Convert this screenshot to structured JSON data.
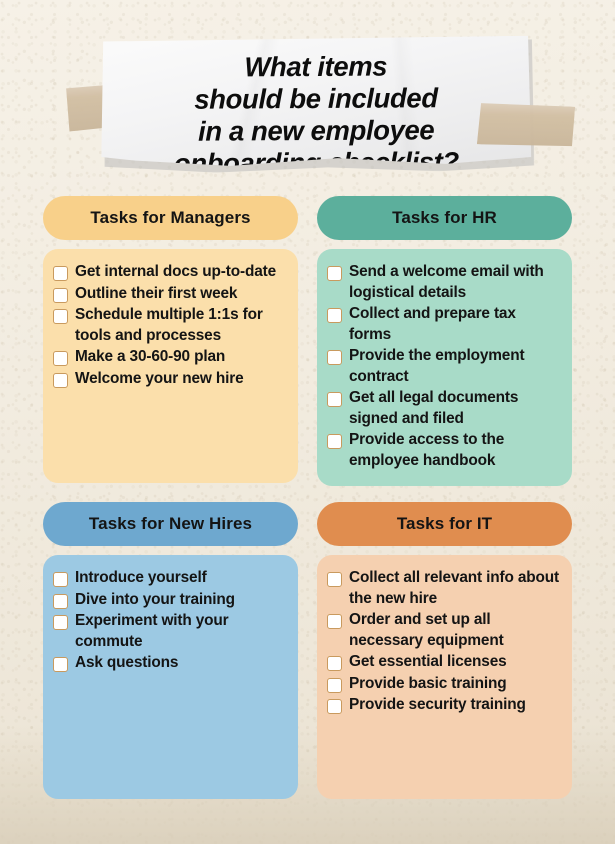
{
  "title": {
    "lines": [
      "What items",
      "should be included",
      "in a new employee",
      "onboarding checklist?"
    ]
  },
  "decor": {
    "tape_left": "tape-strip",
    "tape_right": "tape-strip",
    "paper": "torn-paper-strip"
  },
  "colors": {
    "background": "#f2ece0",
    "tape": "#d2bfa4",
    "paper": "#f4f4f5",
    "title_text": "#0d0d0d",
    "checkbox_border": "#c99a5e",
    "checkbox_fill": "#ffffff",
    "managers_header": "#f8d08a",
    "managers_body": "#fbdfab",
    "hr_header": "#5caf9c",
    "hr_body": "#a8dbc8",
    "newhires_header": "#6ea8cf",
    "newhires_body": "#9cc9e3",
    "it_header": "#e08d4f",
    "it_body": "#f5d0b0"
  },
  "cards": [
    {
      "id": "managers",
      "header": "Tasks for Managers",
      "header_color": "#f8d08a",
      "body_color": "#fbdfab",
      "tasks": [
        "Get internal docs up-to-date",
        "Outline their first week",
        "Schedule multiple 1:1s for tools and processes",
        "Make a 30-60-90 plan",
        "Welcome your new hire"
      ]
    },
    {
      "id": "hr",
      "header": "Tasks for HR",
      "header_color": "#5caf9c",
      "body_color": "#a8dbc8",
      "tasks": [
        "Send a welcome email with logistical details",
        "Collect and prepare tax forms",
        "Provide the employment contract",
        "Get all legal documents signed and filed",
        "Provide access to the employee handbook"
      ]
    },
    {
      "id": "new-hires",
      "header": "Tasks for New Hires",
      "header_color": "#6ea8cf",
      "body_color": "#9cc9e3",
      "tasks": [
        "Introduce yourself",
        "Dive into your training",
        "Experiment with your commute",
        "Ask questions"
      ]
    },
    {
      "id": "it",
      "header": "Tasks for IT",
      "header_color": "#e08d4f",
      "body_color": "#f5d0b0",
      "tasks": [
        "Collect all relevant info about the new hire",
        "Order and set up all necessary equipment",
        "Get essential licenses",
        "Provide basic training",
        "Provide security training"
      ]
    }
  ]
}
